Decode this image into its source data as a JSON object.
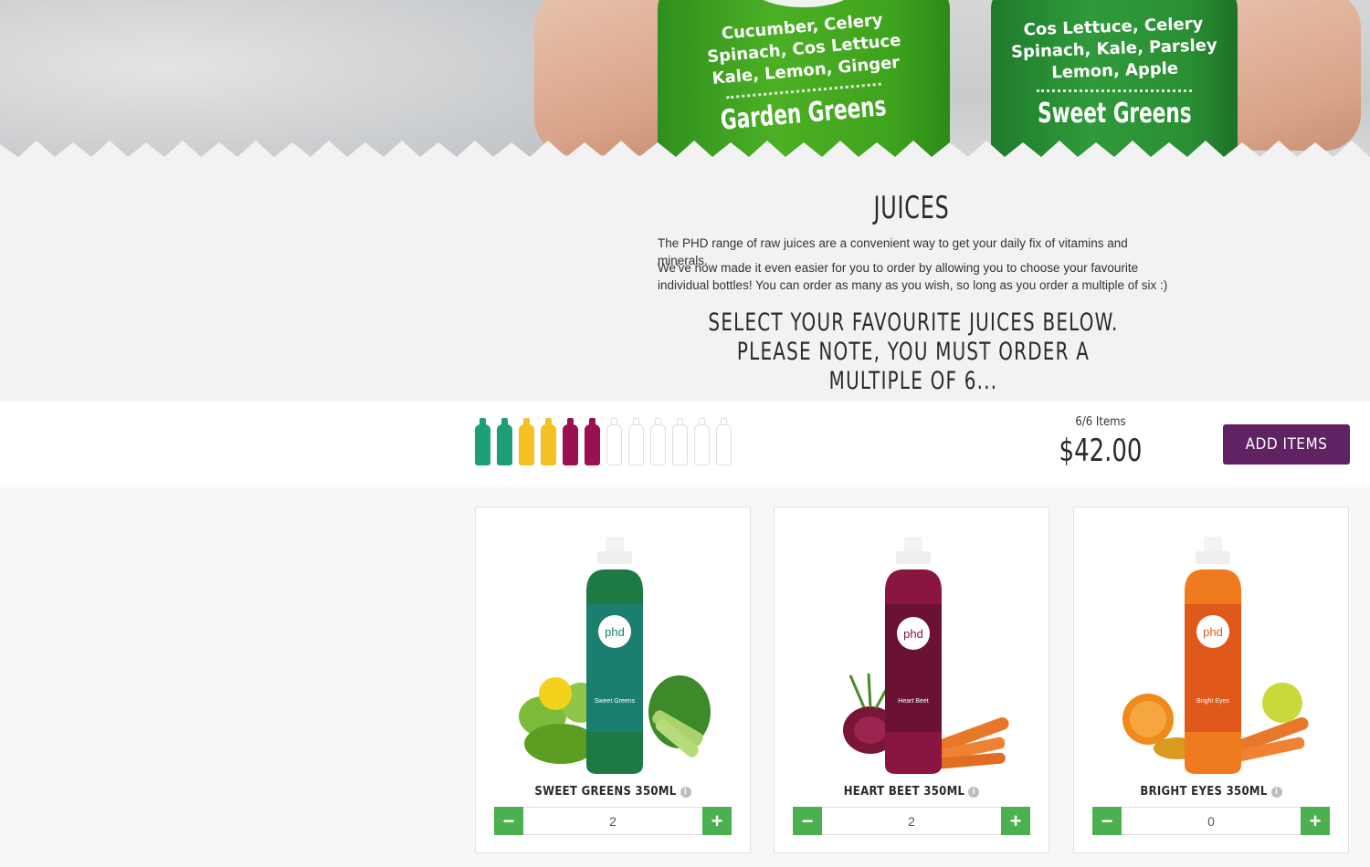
{
  "hero": {
    "bottles": [
      {
        "ingredients": [
          "Cucumber, Celery",
          "Spinach, Cos Lettuce",
          "Kale, Lemon, Ginger"
        ],
        "name": "Garden Greens"
      },
      {
        "ingredients": [
          "Cos Lettuce, Celery",
          "Spinach, Kale, Parsley",
          "Lemon, Apple"
        ],
        "name": "Sweet Greens"
      }
    ]
  },
  "intro": {
    "title": "JUICES",
    "paragraph1": "The PHD range of raw juices are a convenient way to get your daily fix of vitamins and minerals.",
    "paragraph2": "We've now made it even easier for you to order by allowing you to choose your favourite individual bottles! You can order as many as you wish, so long as you order a multiple of six :)",
    "notice_line1": "SELECT YOUR FAVOURITE JUICES BELOW.",
    "notice_line2": "PLEASE NOTE, YOU MUST ORDER A MULTIPLE OF 6..."
  },
  "order": {
    "selected_colors": [
      "#1e9e77",
      "#1e9e77",
      "#f5c021",
      "#f5c021",
      "#9b1050",
      "#9b1050"
    ],
    "empty_slots": 6,
    "count_label": "6/6 Items",
    "price": "$42.00",
    "add_button": "ADD ITEMS"
  },
  "products": [
    {
      "name": "SWEET GREENS 350ML",
      "quantity": "2",
      "minus": "−",
      "plus": "+",
      "color": "#1d8f5a",
      "label_color": "#1a7f6e",
      "bottle_name": "Sweet Greens"
    },
    {
      "name": "HEART BEET 350ML",
      "quantity": "2",
      "minus": "−",
      "plus": "+",
      "color": "#8a1540",
      "label_color": "#6b1234",
      "bottle_name": "Heart Beet"
    },
    {
      "name": "BRIGHT EYES 350ML",
      "quantity": "0",
      "minus": "−",
      "plus": "+",
      "color": "#f07a1e",
      "label_color": "#e0581a",
      "bottle_name": "Bright Eyes"
    }
  ],
  "icons": {
    "info": "i",
    "logo": "phd"
  }
}
